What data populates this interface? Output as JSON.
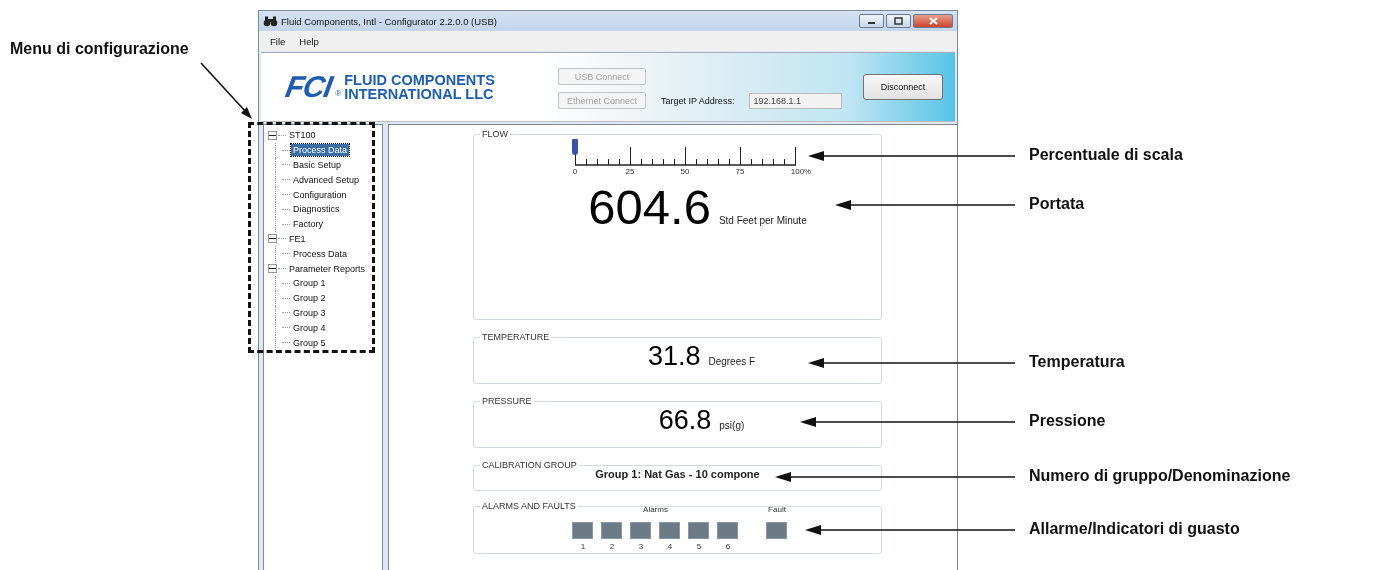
{
  "window": {
    "title": "Fluid Components, Intl - Configurator 2.2.0.0 (USB)"
  },
  "menu": [
    "File",
    "Help"
  ],
  "header": {
    "logo_mark": "FCI",
    "logo_registered": "®",
    "logo_lines": [
      "FLUID COMPONENTS",
      "INTERNATIONAL LLC"
    ],
    "buttons": [
      {
        "label": "USB Connect",
        "disabled": true
      },
      {
        "label": "Ethernet Connect",
        "disabled": true
      },
      {
        "label": "Disconnect",
        "disabled": false
      }
    ],
    "ip_label": "Target IP Address:",
    "ip_value": "192.168.1.1"
  },
  "tree": [
    {
      "label": "ST100",
      "expanded": true,
      "selected": false,
      "children": [
        {
          "label": "Process Data",
          "selected": true
        },
        {
          "label": "Basic Setup",
          "selected": false
        },
        {
          "label": "Advanced Setup",
          "selected": false
        },
        {
          "label": "Configuration",
          "selected": false
        },
        {
          "label": "Diagnostics",
          "selected": false
        },
        {
          "label": "Factory",
          "selected": false
        }
      ]
    },
    {
      "label": "FE1",
      "expanded": true,
      "selected": false,
      "children": [
        {
          "label": "Process Data",
          "selected": false
        }
      ]
    },
    {
      "label": "Parameter Reports",
      "expanded": true,
      "selected": false,
      "children": [
        {
          "label": "Group 1",
          "selected": false
        },
        {
          "label": "Group 2",
          "selected": false
        },
        {
          "label": "Group 3",
          "selected": false
        },
        {
          "label": "Group 4",
          "selected": false
        },
        {
          "label": "Group 5",
          "selected": false
        }
      ]
    }
  ],
  "panels": [
    {
      "kind": "gauge",
      "title": "FLOW",
      "scale": [
        "0",
        "25",
        "50",
        "75",
        "100%"
      ],
      "value": "604.6",
      "unit": "Std Feet per Minute"
    },
    {
      "kind": "reading",
      "title": "TEMPERATURE",
      "value": "31.8",
      "unit": "Degrees F"
    },
    {
      "kind": "reading",
      "title": "PRESSURE",
      "value": "66.8",
      "unit": "psi(g)"
    },
    {
      "kind": "text",
      "title": "CALIBRATION GROUP",
      "value": "Group 1: Nat Gas - 10 compone"
    },
    {
      "kind": "alarms",
      "title": "ALARMS AND FAULTS",
      "alarms_label": "Alarms",
      "fault_label": "Fault",
      "alarms": [
        {
          "label": "1",
          "on": false
        },
        {
          "label": "2",
          "on": false
        },
        {
          "label": "3",
          "on": false
        },
        {
          "label": "4",
          "on": false
        },
        {
          "label": "5",
          "on": false
        },
        {
          "label": "6",
          "on": false
        }
      ],
      "fault": {
        "on": false
      }
    }
  ],
  "annotations": {
    "left": "Menu di configurazione",
    "right": [
      "Percentuale di scala",
      "Portata",
      "Temperatura",
      "Pressione",
      "Numero di gruppo/Denominazione",
      "Allarme/Indicatori di guasto"
    ]
  }
}
